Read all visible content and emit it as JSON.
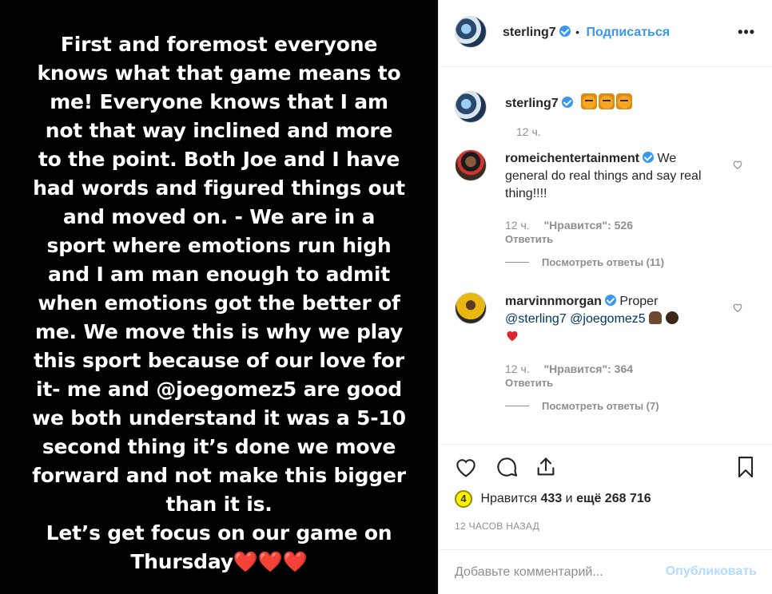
{
  "story": {
    "text": "First and foremost everyone knows what that game means to me!  Everyone knows that I am not that way inclined and more to the point. Both Joe and I have had words and figured things out and moved on. - We are in a sport where emotions run high and I am man enough to admit when emotions got the better of me. We move this is why we play this sport because of our love for it- me and @joegomez5 are good we both understand it was a 5-10 second thing it’s done we move forward and not make this bigger  than it is.\nLet’s get focus on our game on Thursday",
    "hearts": "❤️❤️❤️"
  },
  "header": {
    "username": "sterling7",
    "separator": "•",
    "follow_label": "Подписаться",
    "more_label": "•••"
  },
  "caption": {
    "username": "sterling7",
    "emoji": "tiger-emoji",
    "time": "12 ч."
  },
  "comments": [
    {
      "username": "romeichentertainment",
      "text": "We general do real things and say real thing!!!!",
      "time": "12 ч.",
      "likes": "\"Нравится\": 526",
      "reply_label": "Ответить",
      "view_replies": "Посмотреть ответы (11)"
    },
    {
      "username": "marvinnmorgan",
      "text": "Proper",
      "mention1": "@sterling7",
      "mention2": "@joegomez5",
      "time": "12 ч.",
      "likes": "\"Нравится\": 364",
      "reply_label": "Ответить",
      "view_replies": "Посмотреть ответы (7)"
    }
  ],
  "actions": {
    "badge": "4",
    "likes_prefix": "Нравится",
    "likes_count": "433",
    "likes_and": "и",
    "likes_more": "ещё 268 716",
    "time_ago": "12 ЧАСОВ НАЗАД"
  },
  "add_comment": {
    "placeholder": "Добавьте комментарий...",
    "publish_label": "Опубликовать"
  },
  "colors": {
    "accent": "#3897f0",
    "muted": "#8e8e8e",
    "heart": "#ed4956"
  }
}
